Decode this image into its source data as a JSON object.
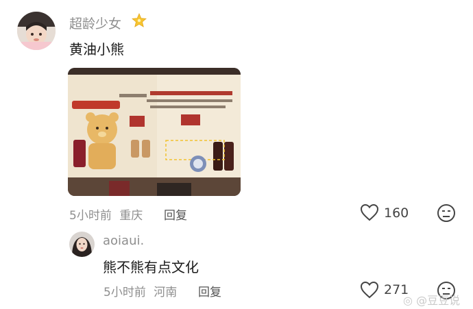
{
  "comments": [
    {
      "username": "超龄少女",
      "badge_icon": "star-badge-icon",
      "text": "黄油小熊",
      "time": "5小时前",
      "location": "重庆",
      "reply_label": "回复",
      "like_count": "160"
    },
    {
      "username": "aoiaui.",
      "text": "熊不熊有点文化",
      "time": "5小时前",
      "location": "河南",
      "reply_label": "回复",
      "like_count": "271"
    }
  ],
  "photo": {
    "header_date": "2025年11月27日-2026年1月31日",
    "slogan": "浓醇 暖暖抱抱",
    "brand": "COSTA"
  },
  "watermark": "@豆豆说",
  "colors": {
    "accent_highlight": "#f2c230",
    "text_primary": "#1a1a1a",
    "text_secondary": "#8e8e8e"
  }
}
